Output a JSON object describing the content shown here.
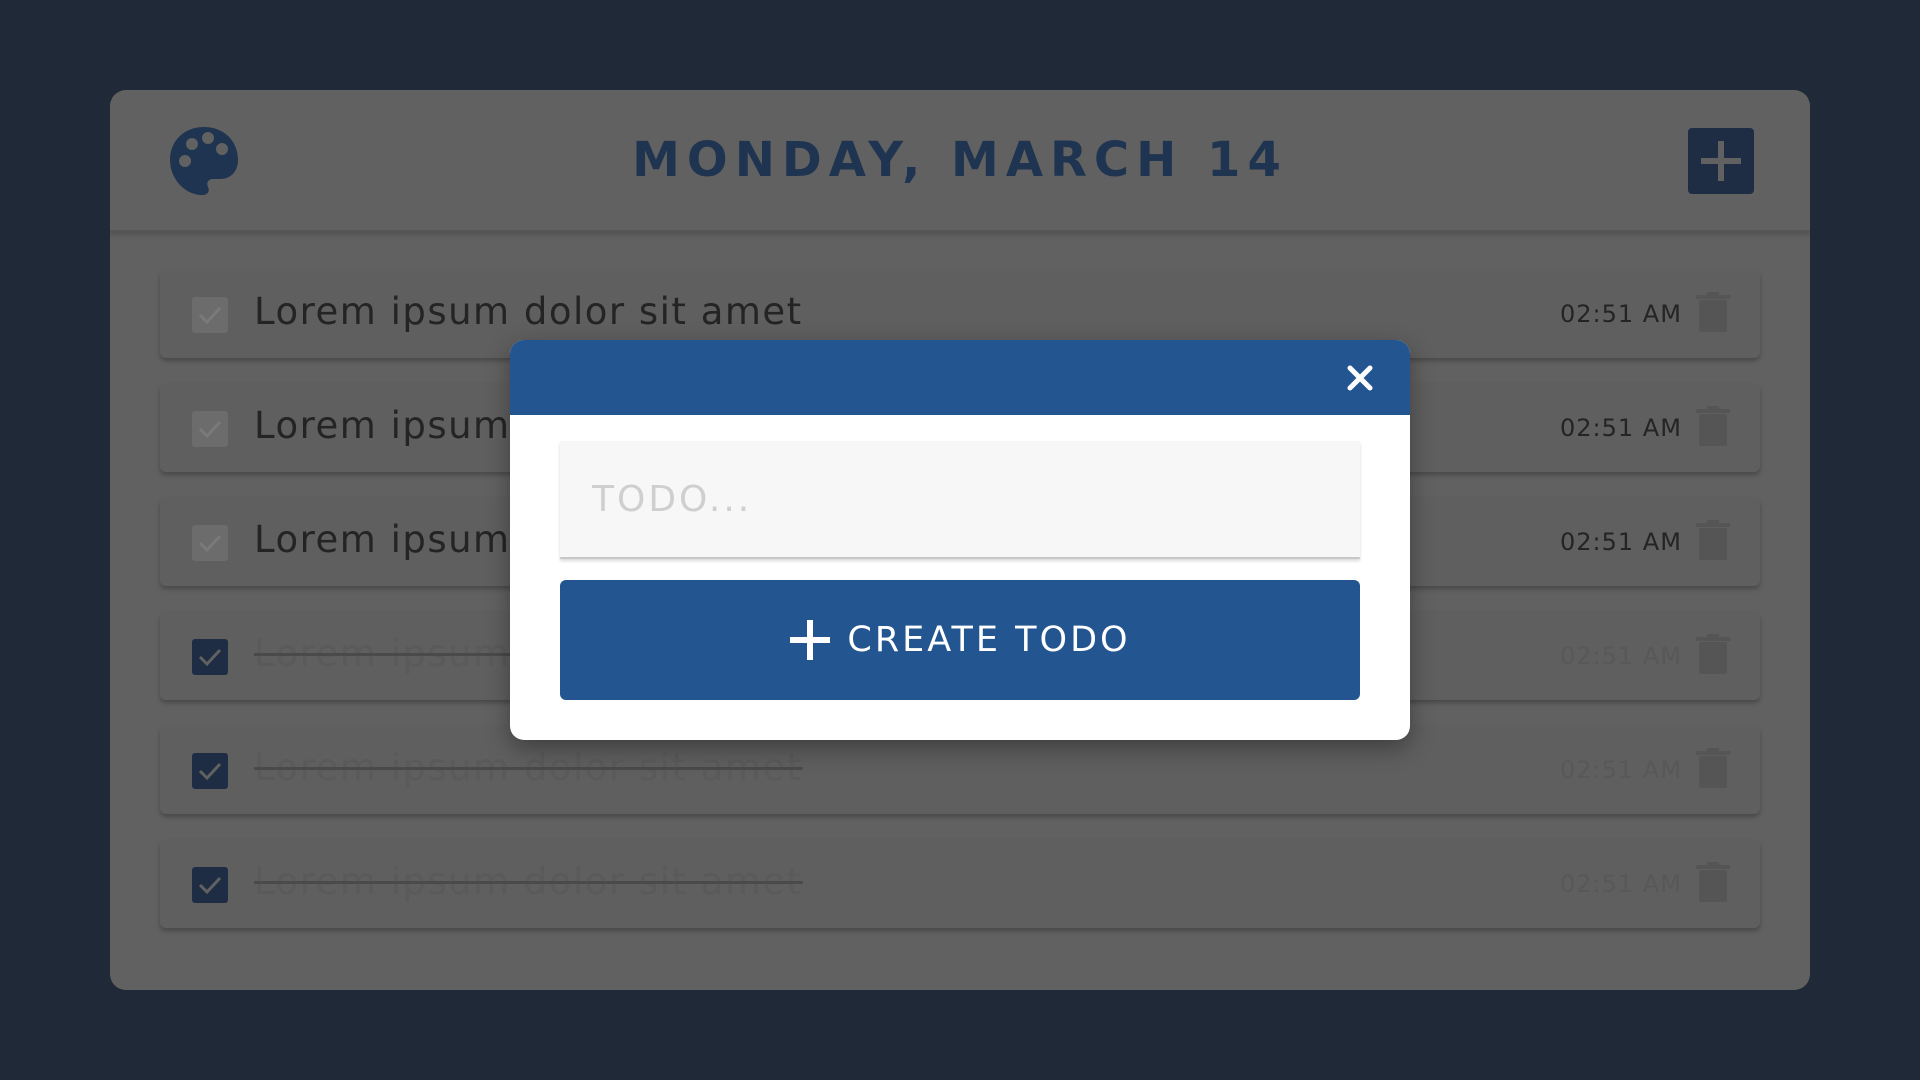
{
  "header": {
    "date": "MONDAY, MARCH 14",
    "palette_icon": "palette-icon",
    "add_icon": "plus-icon"
  },
  "todos": [
    {
      "text": "Lorem ipsum dolor sit amet",
      "time": "02:51 AM",
      "checked": false
    },
    {
      "text": "Lorem ipsum dolor sit amet",
      "time": "02:51 AM",
      "checked": false
    },
    {
      "text": "Lorem ipsum dolor sit amet",
      "time": "02:51 AM",
      "checked": false
    },
    {
      "text": "Lorem ipsum dolor sit amet",
      "time": "02:51 AM",
      "checked": true
    },
    {
      "text": "Lorem ipsum dolor sit amet",
      "time": "02:51 AM",
      "checked": true
    },
    {
      "text": "Lorem ipsum dolor sit amet",
      "time": "02:51 AM",
      "checked": true
    }
  ],
  "modal": {
    "close_icon": "close-icon",
    "input_placeholder": "TODO...",
    "input_value": "",
    "create_label": "CREATE TODO",
    "create_icon": "plus-icon"
  },
  "colors": {
    "background": "#1f2937",
    "accent": "#235590",
    "dark_navy": "#1f2d44"
  }
}
